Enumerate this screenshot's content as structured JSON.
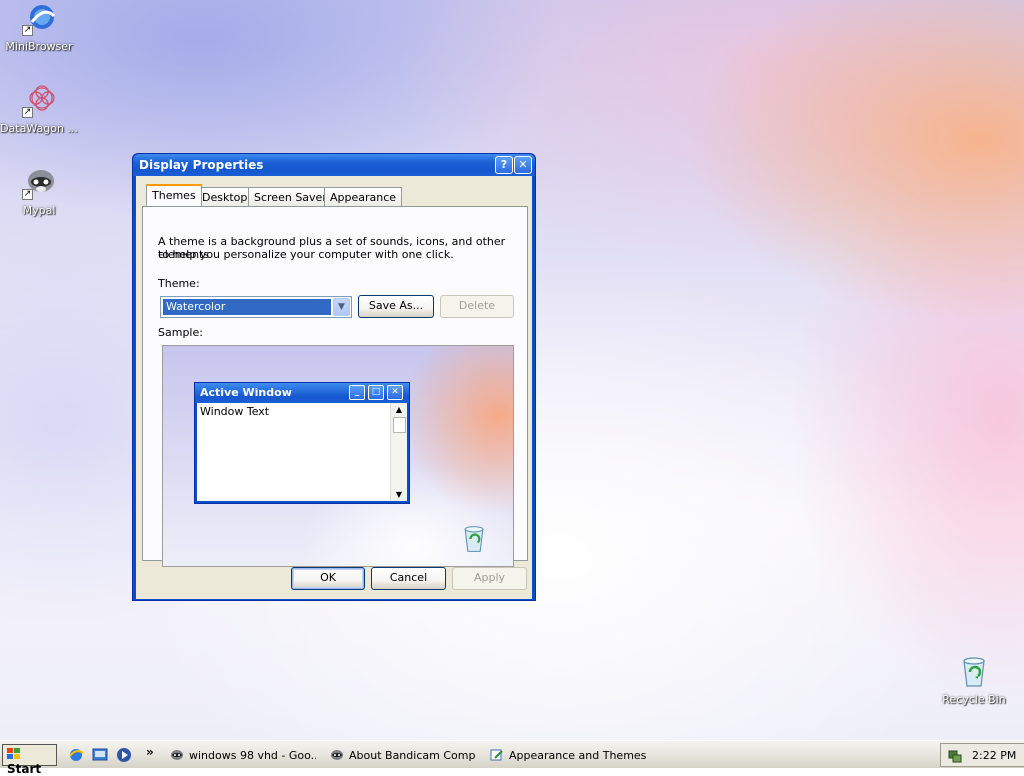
{
  "desktop": {
    "icons": [
      {
        "label": "MiniBrowser",
        "icon": "minibrowser-icon"
      },
      {
        "label": "DataWagon ...",
        "icon": "datawagon-icon"
      },
      {
        "label": "Mypal",
        "icon": "mypal-icon"
      },
      {
        "label": "Recycle Bin",
        "icon": "recycle-bin-icon"
      }
    ]
  },
  "dialog": {
    "title": "Display Properties",
    "help_glyph": "?",
    "close_glyph": "✕",
    "tabs": [
      {
        "label": "Themes",
        "active": true
      },
      {
        "label": "Desktop",
        "active": false
      },
      {
        "label": "Screen Saver",
        "active": false
      },
      {
        "label": "Appearance",
        "active": false
      }
    ],
    "description_line1": "A theme is a background plus a set of sounds, icons, and other elements",
    "description_line2": "to help you personalize your computer with one click.",
    "theme_label": "Theme:",
    "theme_value": "Watercolor",
    "save_as_label": "Save As...",
    "delete_label": "Delete",
    "sample_label": "Sample:",
    "sample": {
      "window_title": "Active Window",
      "window_text": "Window Text",
      "minimize_glyph": "_",
      "maximize_glyph": "□",
      "close_glyph": "✕"
    },
    "ok_label": "OK",
    "cancel_label": "Cancel",
    "apply_label": "Apply"
  },
  "taskbar": {
    "start_label": "Start",
    "overflow_glyph": "»",
    "tasks": [
      {
        "label": "windows 98 vhd - Goo...",
        "icon": "raccoon-icon"
      },
      {
        "label": "About Bandicam Comp...",
        "icon": "raccoon-icon"
      },
      {
        "label": "Appearance and Themes",
        "icon": "control-panel-icon"
      }
    ],
    "clock": "2:22 PM"
  },
  "colors": {
    "titlebar_blue": "#1457cf",
    "dialog_face": "#ece9d8",
    "selection_blue": "#316ac5",
    "tab_highlight": "#ff9b00"
  }
}
